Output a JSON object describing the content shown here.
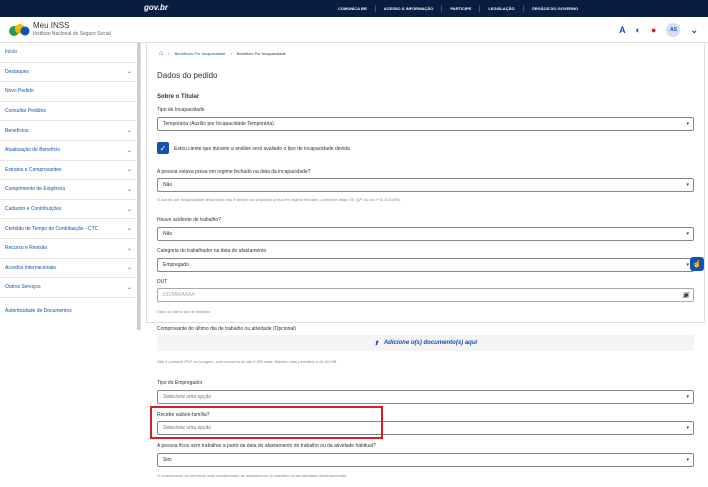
{
  "topbar": {
    "brand": "gov.br",
    "links": [
      "COMUNICA BR",
      "ACESSO À INFORMAÇÃO",
      "PARTICIPE",
      "LEGISLAÇÃO",
      "ÓRGÃOS DO GOVERNO"
    ]
  },
  "header": {
    "title": "Meu INSS",
    "subtitle": "Instituto Nacional do Seguro Social",
    "font_icon": "A",
    "contrast_icon": "◐",
    "notification_icon": "●",
    "avatar": "AS"
  },
  "sidebar": {
    "items": [
      {
        "label": "Início",
        "chevron": false
      },
      {
        "label": "Destaques",
        "chevron": true
      },
      {
        "label": "Novo Pedido",
        "chevron": false
      },
      {
        "label": "Consultar Pedidos",
        "chevron": false
      },
      {
        "label": "Benefícios",
        "chevron": true
      },
      {
        "label": "Atualização de Benefício",
        "chevron": true
      },
      {
        "label": "Extratos e Comprovantes",
        "chevron": true
      },
      {
        "label": "Cumprimento de Exigência",
        "chevron": true
      },
      {
        "label": "Cadastro e Contribuições",
        "chevron": true
      },
      {
        "label": "Certidão de Tempo de Contribuição - CTC",
        "chevron": true
      },
      {
        "label": "Recurso e Revisão",
        "chevron": true
      },
      {
        "label": "Acordos Internacionais",
        "chevron": true
      },
      {
        "label": "Outros Serviços",
        "chevron": true
      },
      {
        "label": "Autenticidade de Documentos",
        "chevron": false
      }
    ]
  },
  "breadcrumb": {
    "item1": "Benefícios Por Incapacidade",
    "item2": "Benefício Por Incapacidade"
  },
  "form": {
    "title": "Dados do pedido",
    "section": "Sobre o Titular",
    "tipo_label": "Tipo de Incapacidade",
    "tipo_value": "Temporária (Auxílio por Incapacidade Temporária)",
    "check_label": "Estou ciente que durante a análise será avaliado o tipo de incapacidade devida",
    "presa_label": "A pessoa estava presa em regime fechado na data da incapacidade?",
    "presa_value": "Não",
    "presa_hint": "O auxílio por incapacidade temporária não é devido ao segurado preso em regime fechado, conforme artigo 59, §2º da Lei nº 8.213/1991.",
    "acidente_label": "Houve acidente de trabalho?",
    "acidente_value": "Não",
    "categoria_label": "Categoria do trabalhador na data do afastamento",
    "categoria_value": "Empregado",
    "dut_label": "DUT",
    "dut_placeholder": "DD/MM/AAAA",
    "dut_hint": "Data do último dia de trabalho",
    "comprovante_label": "Comprovante do último dia de trabalho ou atividade (Opcional)",
    "upload_label": "Adicione o(s) documento(s) aqui",
    "upload_hint": "São é possível PDF ou Imagem, com tamanho de até 5 MB cada. Máximo total permitido é de 50 MB",
    "empregador_label": "Tipo do Empregador",
    "empregador_placeholder": "Selecione uma opção",
    "salario_label": "Recebe salário-família?",
    "salario_placeholder": "Selecione uma opção",
    "ficou_label": "A pessoa ficou sem trabalhar a partir da data do afastamento do trabalho ou da atividade habitual?",
    "ficou_value": "Sim",
    "ficou_hint": "O recebimento do benefício está condicionado ao afastamento do trabalho ou da atividade desempenhada."
  },
  "colors": {
    "primary": "#1351b4",
    "topbar": "#071d41",
    "highlight": "#d81f26"
  }
}
